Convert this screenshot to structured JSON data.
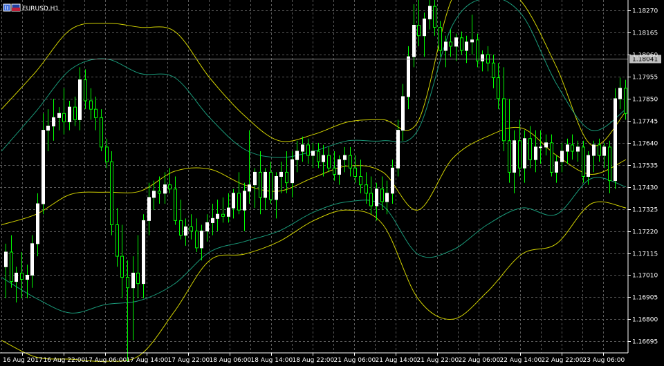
{
  "chart_data": {
    "type": "candlestick",
    "symbol_title": "EURUSD,H1",
    "current_price": 1.18041,
    "ylim": [
      1.1664,
      1.1832
    ],
    "grid": true,
    "y_ticks": [
      "1.18270",
      "1.18165",
      "1.18060",
      "1.17955",
      "1.17850",
      "1.17745",
      "1.17640",
      "1.17535",
      "1.17430",
      "1.17325",
      "1.17220",
      "1.17115",
      "1.17010",
      "1.16905",
      "1.16800",
      "1.16695"
    ],
    "x_ticks": [
      "16 Aug 2017",
      "16 Aug 22:00",
      "17 Aug 06:00",
      "17 Aug 14:00",
      "17 Aug 22:00",
      "18 Aug 06:00",
      "18 Aug 14:00",
      "18 Aug 22:00",
      "21 Aug 06:00",
      "21 Aug 14:00",
      "21 Aug 22:00",
      "22 Aug 06:00",
      "22 Aug 14:00",
      "22 Aug 22:00",
      "23 Aug 06:00"
    ],
    "colors": {
      "background": "#000000",
      "grid": "#5a5a5a",
      "axis": "#ffffff",
      "bull_candle": "#ffffff",
      "bear_candle": "#00ff00",
      "wick": "#00ff00",
      "outer_bands": "#d4d400",
      "inner_bands": "#1a9a7a",
      "price_line": "#8f8f8f",
      "price_tag": "#c0c0c0"
    },
    "outer_upper_band": [
      1.178,
      1.1798,
      1.1818,
      1.1821,
      1.1819,
      1.1817,
      1.1795,
      1.1777,
      1.1765,
      1.1768,
      1.1774,
      1.1775,
      1.1774,
      1.1833,
      1.1841,
      1.1831,
      1.18,
      1.1763,
      1.1779
    ],
    "outer_lower_band": [
      1.167,
      1.1662,
      1.1661,
      1.166,
      1.1663,
      1.1684,
      1.1708,
      1.1711,
      1.1717,
      1.1727,
      1.1732,
      1.1725,
      1.169,
      1.168,
      1.1693,
      1.1711,
      1.1716,
      1.1735,
      1.1733
    ],
    "inner_upper_band": [
      1.176,
      1.1779,
      1.1799,
      1.1804,
      1.1797,
      1.1795,
      1.1776,
      1.1761,
      1.1757,
      1.176,
      1.1765,
      1.1765,
      1.177,
      1.182,
      1.1833,
      1.1825,
      1.1792,
      1.177,
      1.178
    ],
    "inner_lower_band": [
      1.17,
      1.169,
      1.1683,
      1.1687,
      1.1689,
      1.1697,
      1.1712,
      1.1717,
      1.1722,
      1.1731,
      1.1736,
      1.1734,
      1.1711,
      1.1713,
      1.1725,
      1.1733,
      1.173,
      1.1747,
      1.1743
    ],
    "candles": [
      {
        "o": 1.1705,
        "h": 1.1716,
        "l": 1.169,
        "c": 1.1712
      },
      {
        "o": 1.1712,
        "h": 1.172,
        "l": 1.1695,
        "c": 1.1698
      },
      {
        "o": 1.1698,
        "h": 1.1705,
        "l": 1.1688,
        "c": 1.1702
      },
      {
        "o": 1.1702,
        "h": 1.1712,
        "l": 1.169,
        "c": 1.1699
      },
      {
        "o": 1.1699,
        "h": 1.1706,
        "l": 1.169,
        "c": 1.1701
      },
      {
        "o": 1.1701,
        "h": 1.172,
        "l": 1.1695,
        "c": 1.1716
      },
      {
        "o": 1.1716,
        "h": 1.174,
        "l": 1.171,
        "c": 1.1735
      },
      {
        "o": 1.1735,
        "h": 1.1778,
        "l": 1.173,
        "c": 1.177
      },
      {
        "o": 1.177,
        "h": 1.178,
        "l": 1.176,
        "c": 1.1772
      },
      {
        "o": 1.1772,
        "h": 1.1785,
        "l": 1.1765,
        "c": 1.1776
      },
      {
        "o": 1.1776,
        "h": 1.1781,
        "l": 1.177,
        "c": 1.1778
      },
      {
        "o": 1.1778,
        "h": 1.179,
        "l": 1.1768,
        "c": 1.1774
      },
      {
        "o": 1.1774,
        "h": 1.1784,
        "l": 1.177,
        "c": 1.1781
      },
      {
        "o": 1.1781,
        "h": 1.1786,
        "l": 1.1772,
        "c": 1.1775
      },
      {
        "o": 1.1775,
        "h": 1.18,
        "l": 1.177,
        "c": 1.1794
      },
      {
        "o": 1.1794,
        "h": 1.1799,
        "l": 1.178,
        "c": 1.1784
      },
      {
        "o": 1.1784,
        "h": 1.179,
        "l": 1.1775,
        "c": 1.178
      },
      {
        "o": 1.178,
        "h": 1.1786,
        "l": 1.177,
        "c": 1.1776
      },
      {
        "o": 1.1776,
        "h": 1.178,
        "l": 1.176,
        "c": 1.1762
      },
      {
        "o": 1.1762,
        "h": 1.1766,
        "l": 1.1752,
        "c": 1.1755
      },
      {
        "o": 1.1755,
        "h": 1.176,
        "l": 1.172,
        "c": 1.1725
      },
      {
        "o": 1.1725,
        "h": 1.1733,
        "l": 1.1705,
        "c": 1.171
      },
      {
        "o": 1.171,
        "h": 1.1725,
        "l": 1.169,
        "c": 1.17
      },
      {
        "o": 1.17,
        "h": 1.1708,
        "l": 1.166,
        "c": 1.1695
      },
      {
        "o": 1.1695,
        "h": 1.171,
        "l": 1.167,
        "c": 1.1702
      },
      {
        "o": 1.1702,
        "h": 1.172,
        "l": 1.169,
        "c": 1.1697
      },
      {
        "o": 1.1697,
        "h": 1.173,
        "l": 1.169,
        "c": 1.1727
      },
      {
        "o": 1.1727,
        "h": 1.1745,
        "l": 1.172,
        "c": 1.1738
      },
      {
        "o": 1.1738,
        "h": 1.1746,
        "l": 1.1732,
        "c": 1.1741
      },
      {
        "o": 1.1741,
        "h": 1.1748,
        "l": 1.1735,
        "c": 1.174
      },
      {
        "o": 1.174,
        "h": 1.175,
        "l": 1.1735,
        "c": 1.1744
      },
      {
        "o": 1.1744,
        "h": 1.1752,
        "l": 1.174,
        "c": 1.1742
      },
      {
        "o": 1.1742,
        "h": 1.1748,
        "l": 1.1725,
        "c": 1.1727
      },
      {
        "o": 1.1727,
        "h": 1.1737,
        "l": 1.1718,
        "c": 1.172
      },
      {
        "o": 1.172,
        "h": 1.1728,
        "l": 1.1715,
        "c": 1.1724
      },
      {
        "o": 1.1724,
        "h": 1.173,
        "l": 1.1718,
        "c": 1.1722
      },
      {
        "o": 1.1722,
        "h": 1.1728,
        "l": 1.1712,
        "c": 1.1714
      },
      {
        "o": 1.1714,
        "h": 1.1725,
        "l": 1.1708,
        "c": 1.1722
      },
      {
        "o": 1.1722,
        "h": 1.173,
        "l": 1.1717,
        "c": 1.1726
      },
      {
        "o": 1.1726,
        "h": 1.1735,
        "l": 1.172,
        "c": 1.1728
      },
      {
        "o": 1.1728,
        "h": 1.1737,
        "l": 1.1722,
        "c": 1.173
      },
      {
        "o": 1.173,
        "h": 1.1738,
        "l": 1.1726,
        "c": 1.1729
      },
      {
        "o": 1.1729,
        "h": 1.174,
        "l": 1.1726,
        "c": 1.1733
      },
      {
        "o": 1.1733,
        "h": 1.1742,
        "l": 1.1728,
        "c": 1.174
      },
      {
        "o": 1.174,
        "h": 1.175,
        "l": 1.173,
        "c": 1.1732
      },
      {
        "o": 1.1732,
        "h": 1.1745,
        "l": 1.1722,
        "c": 1.1741
      },
      {
        "o": 1.1741,
        "h": 1.177,
        "l": 1.1735,
        "c": 1.1744
      },
      {
        "o": 1.1744,
        "h": 1.1752,
        "l": 1.1733,
        "c": 1.175
      },
      {
        "o": 1.175,
        "h": 1.176,
        "l": 1.173,
        "c": 1.1738
      },
      {
        "o": 1.1738,
        "h": 1.1752,
        "l": 1.1732,
        "c": 1.175
      },
      {
        "o": 1.175,
        "h": 1.1755,
        "l": 1.1735,
        "c": 1.1737
      },
      {
        "o": 1.1737,
        "h": 1.175,
        "l": 1.1728,
        "c": 1.1748
      },
      {
        "o": 1.1748,
        "h": 1.1755,
        "l": 1.174,
        "c": 1.175
      },
      {
        "o": 1.175,
        "h": 1.176,
        "l": 1.174,
        "c": 1.1745
      },
      {
        "o": 1.1745,
        "h": 1.176,
        "l": 1.1738,
        "c": 1.1756
      },
      {
        "o": 1.1756,
        "h": 1.1765,
        "l": 1.175,
        "c": 1.176
      },
      {
        "o": 1.176,
        "h": 1.1767,
        "l": 1.1755,
        "c": 1.1763
      },
      {
        "o": 1.1763,
        "h": 1.1766,
        "l": 1.1754,
        "c": 1.1758
      },
      {
        "o": 1.1758,
        "h": 1.1764,
        "l": 1.1752,
        "c": 1.176
      },
      {
        "o": 1.176,
        "h": 1.1764,
        "l": 1.1752,
        "c": 1.1755
      },
      {
        "o": 1.1755,
        "h": 1.1763,
        "l": 1.1748,
        "c": 1.1758
      },
      {
        "o": 1.1758,
        "h": 1.1762,
        "l": 1.175,
        "c": 1.1752
      },
      {
        "o": 1.1752,
        "h": 1.176,
        "l": 1.1746,
        "c": 1.1749
      },
      {
        "o": 1.1749,
        "h": 1.1758,
        "l": 1.1744,
        "c": 1.1756
      },
      {
        "o": 1.1756,
        "h": 1.1762,
        "l": 1.175,
        "c": 1.1758
      },
      {
        "o": 1.1758,
        "h": 1.1762,
        "l": 1.1748,
        "c": 1.1752
      },
      {
        "o": 1.1752,
        "h": 1.1758,
        "l": 1.1745,
        "c": 1.1748
      },
      {
        "o": 1.1748,
        "h": 1.1756,
        "l": 1.174,
        "c": 1.1744
      },
      {
        "o": 1.1744,
        "h": 1.175,
        "l": 1.1735,
        "c": 1.174
      },
      {
        "o": 1.174,
        "h": 1.1748,
        "l": 1.173,
        "c": 1.1734
      },
      {
        "o": 1.1734,
        "h": 1.1745,
        "l": 1.1727,
        "c": 1.1742
      },
      {
        "o": 1.1742,
        "h": 1.1748,
        "l": 1.1732,
        "c": 1.1736
      },
      {
        "o": 1.1736,
        "h": 1.1746,
        "l": 1.173,
        "c": 1.174
      },
      {
        "o": 1.174,
        "h": 1.1756,
        "l": 1.1735,
        "c": 1.1752
      },
      {
        "o": 1.1752,
        "h": 1.1775,
        "l": 1.1748,
        "c": 1.177
      },
      {
        "o": 1.177,
        "h": 1.1792,
        "l": 1.1765,
        "c": 1.1786
      },
      {
        "o": 1.1786,
        "h": 1.181,
        "l": 1.178,
        "c": 1.1805
      },
      {
        "o": 1.1805,
        "h": 1.183,
        "l": 1.18,
        "c": 1.182
      },
      {
        "o": 1.182,
        "h": 1.1836,
        "l": 1.181,
        "c": 1.1815
      },
      {
        "o": 1.1815,
        "h": 1.1826,
        "l": 1.1805,
        "c": 1.1823
      },
      {
        "o": 1.1823,
        "h": 1.1838,
        "l": 1.1818,
        "c": 1.1829
      },
      {
        "o": 1.1829,
        "h": 1.1835,
        "l": 1.1815,
        "c": 1.1819
      },
      {
        "o": 1.1819,
        "h": 1.1822,
        "l": 1.1805,
        "c": 1.1808
      },
      {
        "o": 1.1808,
        "h": 1.1815,
        "l": 1.18,
        "c": 1.1812
      },
      {
        "o": 1.1812,
        "h": 1.1818,
        "l": 1.1805,
        "c": 1.181
      },
      {
        "o": 1.181,
        "h": 1.1816,
        "l": 1.1803,
        "c": 1.1814
      },
      {
        "o": 1.1814,
        "h": 1.1817,
        "l": 1.1806,
        "c": 1.1808
      },
      {
        "o": 1.1808,
        "h": 1.1815,
        "l": 1.1802,
        "c": 1.1812
      },
      {
        "o": 1.1812,
        "h": 1.1825,
        "l": 1.1806,
        "c": 1.1813
      },
      {
        "o": 1.1813,
        "h": 1.1816,
        "l": 1.18,
        "c": 1.1803
      },
      {
        "o": 1.1803,
        "h": 1.1808,
        "l": 1.1798,
        "c": 1.1806
      },
      {
        "o": 1.1806,
        "h": 1.181,
        "l": 1.1798,
        "c": 1.1802
      },
      {
        "o": 1.1802,
        "h": 1.1806,
        "l": 1.179,
        "c": 1.1795
      },
      {
        "o": 1.1795,
        "h": 1.1802,
        "l": 1.178,
        "c": 1.1785
      },
      {
        "o": 1.1785,
        "h": 1.18,
        "l": 1.176,
        "c": 1.1765
      },
      {
        "o": 1.1765,
        "h": 1.1785,
        "l": 1.1745,
        "c": 1.175
      },
      {
        "o": 1.175,
        "h": 1.177,
        "l": 1.174,
        "c": 1.1765
      },
      {
        "o": 1.1765,
        "h": 1.1775,
        "l": 1.1748,
        "c": 1.1752
      },
      {
        "o": 1.1752,
        "h": 1.177,
        "l": 1.1745,
        "c": 1.1766
      },
      {
        "o": 1.1766,
        "h": 1.1772,
        "l": 1.1752,
        "c": 1.1756
      },
      {
        "o": 1.1756,
        "h": 1.177,
        "l": 1.175,
        "c": 1.1762
      },
      {
        "o": 1.1762,
        "h": 1.177,
        "l": 1.1754,
        "c": 1.1762
      },
      {
        "o": 1.1762,
        "h": 1.1768,
        "l": 1.1758,
        "c": 1.1764
      },
      {
        "o": 1.1764,
        "h": 1.1768,
        "l": 1.1748,
        "c": 1.175
      },
      {
        "o": 1.175,
        "h": 1.1758,
        "l": 1.1745,
        "c": 1.1755
      },
      {
        "o": 1.1755,
        "h": 1.1764,
        "l": 1.175,
        "c": 1.176
      },
      {
        "o": 1.176,
        "h": 1.1766,
        "l": 1.1754,
        "c": 1.1763
      },
      {
        "o": 1.1763,
        "h": 1.1768,
        "l": 1.1756,
        "c": 1.176
      },
      {
        "o": 1.176,
        "h": 1.1765,
        "l": 1.1755,
        "c": 1.1762
      },
      {
        "o": 1.1762,
        "h": 1.1765,
        "l": 1.1745,
        "c": 1.1748
      },
      {
        "o": 1.1748,
        "h": 1.176,
        "l": 1.1744,
        "c": 1.1758
      },
      {
        "o": 1.1758,
        "h": 1.1765,
        "l": 1.175,
        "c": 1.1763
      },
      {
        "o": 1.1763,
        "h": 1.1766,
        "l": 1.1755,
        "c": 1.1758
      },
      {
        "o": 1.1758,
        "h": 1.1764,
        "l": 1.1752,
        "c": 1.1762
      },
      {
        "o": 1.1762,
        "h": 1.1765,
        "l": 1.174,
        "c": 1.1746
      },
      {
        "o": 1.1746,
        "h": 1.179,
        "l": 1.1742,
        "c": 1.1785
      },
      {
        "o": 1.1785,
        "h": 1.1795,
        "l": 1.178,
        "c": 1.179
      },
      {
        "o": 1.179,
        "h": 1.1794,
        "l": 1.1775,
        "c": 1.1778
      }
    ]
  }
}
